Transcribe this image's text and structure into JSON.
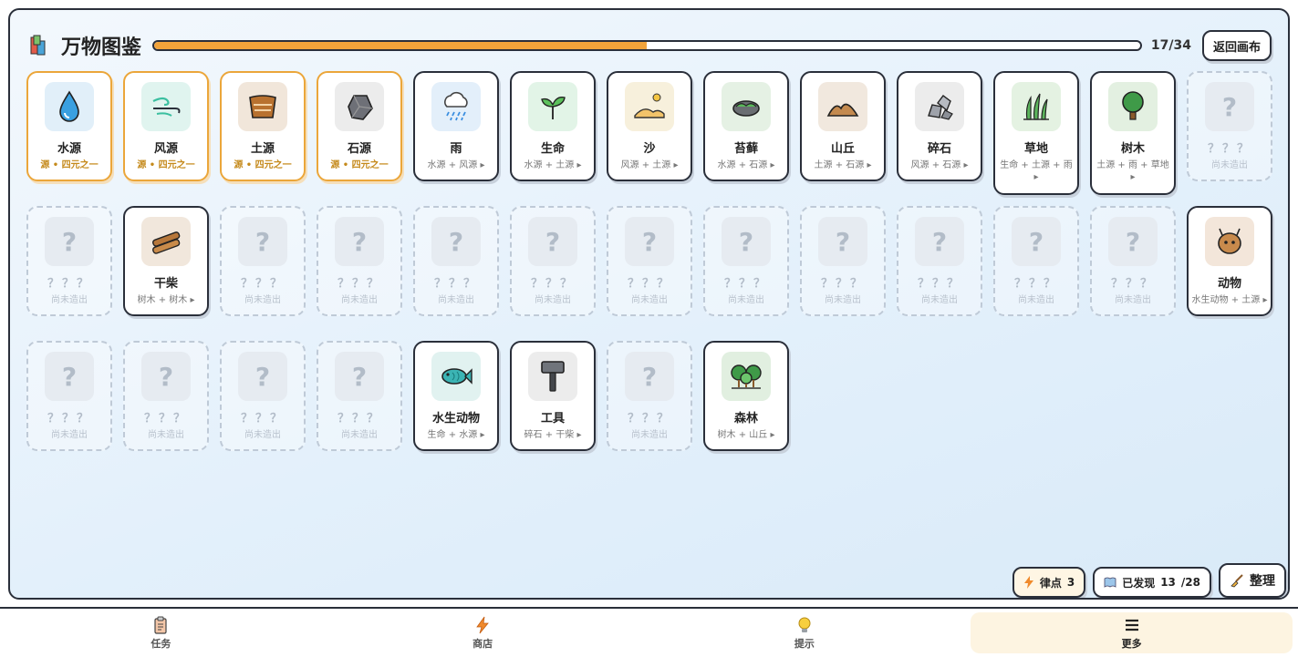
{
  "header": {
    "title": "万物图鉴",
    "count": "17/34",
    "progress": 0.5,
    "back_label": "返回画布"
  },
  "items": [
    {
      "name": "水源",
      "sub": "源 • 四元之一",
      "state": "base",
      "icon": "water-drop-icon",
      "bg": "#e1eff9"
    },
    {
      "name": "风源",
      "sub": "源 • 四元之一",
      "state": "base",
      "icon": "wind-icon",
      "bg": "#e0f4ef"
    },
    {
      "name": "土源",
      "sub": "源 • 四元之一",
      "state": "base",
      "icon": "soil-icon",
      "bg": "#f1e6da"
    },
    {
      "name": "石源",
      "sub": "源 • 四元之一",
      "state": "base",
      "icon": "stone-icon",
      "bg": "#ececec"
    },
    {
      "name": "雨",
      "sub": "水源 + 风源 ▸",
      "state": "found",
      "icon": "rain-icon",
      "bg": "#e3effa"
    },
    {
      "name": "生命",
      "sub": "水源 + 土源 ▸",
      "state": "found",
      "icon": "sprout-icon",
      "bg": "#e2f4e7"
    },
    {
      "name": "沙",
      "sub": "风源 + 土源 ▸",
      "state": "found",
      "icon": "sand-icon",
      "bg": "#f7f0dc"
    },
    {
      "name": "苔藓",
      "sub": "水源 + 石源 ▸",
      "state": "found",
      "icon": "moss-icon",
      "bg": "#e5f1e4"
    },
    {
      "name": "山丘",
      "sub": "土源 + 石源 ▸",
      "state": "found",
      "icon": "hill-icon",
      "bg": "#f1e8de"
    },
    {
      "name": "碎石",
      "sub": "风源 + 石源 ▸",
      "state": "found",
      "icon": "gravel-icon",
      "bg": "#ececec"
    },
    {
      "name": "草地",
      "sub": "生命 + 土源 + 雨 ▸",
      "state": "found",
      "icon": "grass-icon",
      "bg": "#e4f2e2"
    },
    {
      "name": "树木",
      "sub": "土源 + 雨 + 草地 ▸",
      "state": "found",
      "icon": "tree-icon",
      "bg": "#e3f0e1"
    },
    {
      "name": "？？？",
      "sub": "尚未造出",
      "state": "locked"
    },
    {
      "name": "？？？",
      "sub": "尚未造出",
      "state": "locked"
    },
    {
      "name": "干柴",
      "sub": "树木 + 树木 ▸",
      "state": "found",
      "icon": "firewood-icon",
      "bg": "#f1e7dc"
    },
    {
      "name": "？？？",
      "sub": "尚未造出",
      "state": "locked"
    },
    {
      "name": "？？？",
      "sub": "尚未造出",
      "state": "locked"
    },
    {
      "name": "？？？",
      "sub": "尚未造出",
      "state": "locked"
    },
    {
      "name": "？？？",
      "sub": "尚未造出",
      "state": "locked"
    },
    {
      "name": "？？？",
      "sub": "尚未造出",
      "state": "locked"
    },
    {
      "name": "？？？",
      "sub": "尚未造出",
      "state": "locked"
    },
    {
      "name": "？？？",
      "sub": "尚未造出",
      "state": "locked"
    },
    {
      "name": "？？？",
      "sub": "尚未造出",
      "state": "locked"
    },
    {
      "name": "？？？",
      "sub": "尚未造出",
      "state": "locked"
    },
    {
      "name": "？？？",
      "sub": "尚未造出",
      "state": "locked"
    },
    {
      "name": "动物",
      "sub": "水生动物 + 土源 ▸",
      "state": "found",
      "icon": "animal-icon",
      "bg": "#f3e6da"
    },
    {
      "name": "？？？",
      "sub": "尚未造出",
      "state": "locked"
    },
    {
      "name": "？？？",
      "sub": "尚未造出",
      "state": "locked"
    },
    {
      "name": "？？？",
      "sub": "尚未造出",
      "state": "locked"
    },
    {
      "name": "？？？",
      "sub": "尚未造出",
      "state": "locked"
    },
    {
      "name": "水生动物",
      "sub": "生命 + 水源 ▸",
      "state": "found",
      "icon": "fish-icon",
      "bg": "#e1f2f0"
    },
    {
      "name": "工具",
      "sub": "碎石 + 干柴 ▸",
      "state": "found",
      "icon": "hammer-icon",
      "bg": "#ececec"
    },
    {
      "name": "？？？",
      "sub": "尚未造出",
      "state": "locked"
    },
    {
      "name": "森林",
      "sub": "树木 + 山丘 ▸",
      "state": "found",
      "icon": "forest-icon",
      "bg": "#e1efe0"
    }
  ],
  "status": {
    "points_label": "律点",
    "points": "3",
    "discovered_label": "已发现",
    "discovered": "13",
    "discovered_total": "/28",
    "tidy_label": "整理"
  },
  "nav": [
    {
      "label": "任务",
      "icon": "clipboard-icon"
    },
    {
      "label": "商店",
      "icon": "lightning-icon"
    },
    {
      "label": "提示",
      "icon": "lightbulb-icon"
    },
    {
      "label": "更多",
      "icon": "menu-icon"
    }
  ]
}
